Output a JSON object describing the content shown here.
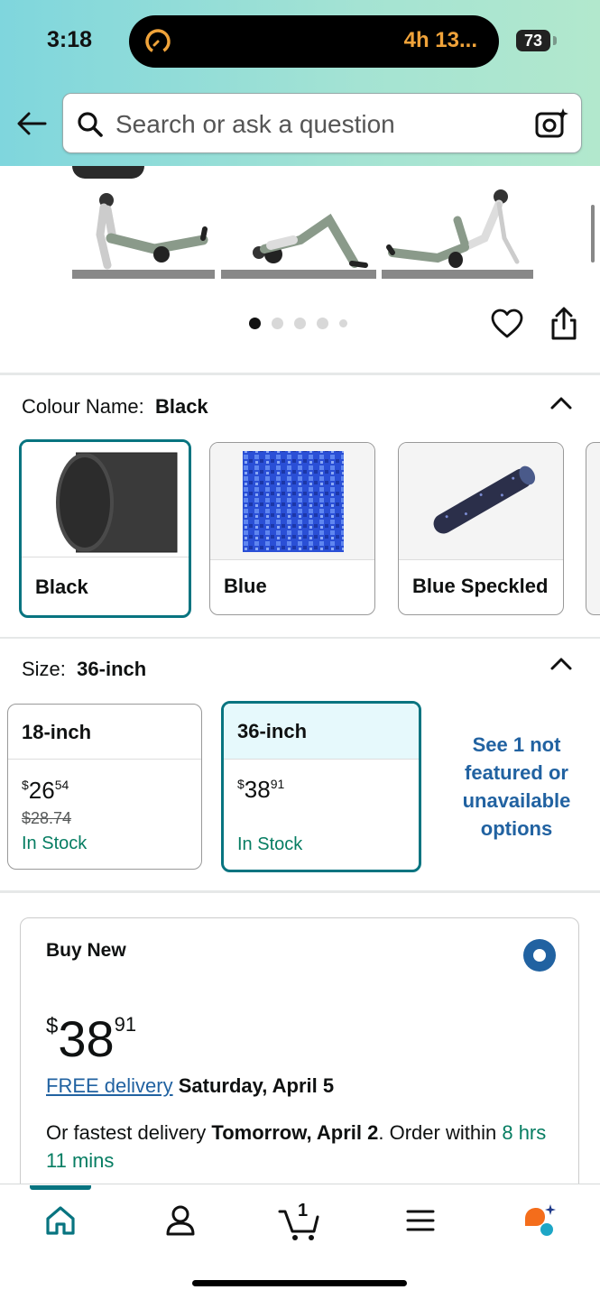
{
  "status_bar": {
    "time": "3:18",
    "activity_text": "4h 13...",
    "battery": "73"
  },
  "search": {
    "placeholder": "Search or ask a question"
  },
  "gallery": {
    "page_count": 5,
    "active_page": 1
  },
  "colour": {
    "label": "Colour Name:",
    "selected": "Black",
    "options": [
      {
        "name": "Black"
      },
      {
        "name": "Blue"
      },
      {
        "name": "Blue Speckled"
      }
    ]
  },
  "size": {
    "label": "Size:",
    "selected": "36-inch",
    "options": [
      {
        "name": "18-inch",
        "price_whole": "26",
        "price_fraction": "54",
        "currency": "$",
        "list_price": "$28.74",
        "availability": "In Stock"
      },
      {
        "name": "36-inch",
        "price_whole": "38",
        "price_fraction": "91",
        "currency": "$",
        "availability": "In Stock"
      }
    ],
    "unavailable_link": "See 1 not featured or unavailable options"
  },
  "buy_box": {
    "title": "Buy New",
    "currency": "$",
    "price_whole": "38",
    "price_fraction": "91",
    "free_delivery_link": "FREE delivery",
    "delivery_date": "Saturday, April 5",
    "fastest_prefix": "Or fastest delivery",
    "fastest_date": "Tomorrow, April 2",
    "order_within_prefix": ". Order within",
    "order_within_time": "8 hrs 11 mins"
  },
  "bottom_nav": {
    "cart_count": "1",
    "items": [
      "home-icon",
      "account-icon",
      "cart-icon",
      "menu-icon",
      "rufus-icon"
    ]
  },
  "colors": {
    "accent": "#087480",
    "link": "#2162a1",
    "in_stock": "#067d62"
  }
}
